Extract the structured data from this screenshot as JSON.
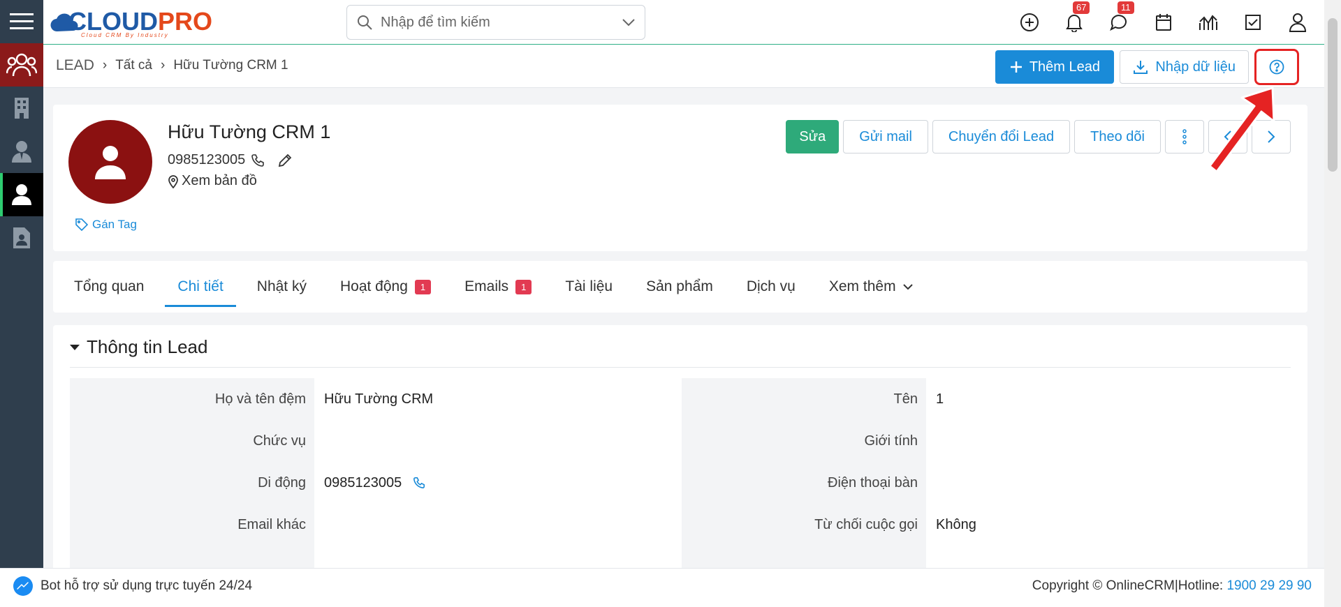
{
  "header": {
    "logo_main": "CLOUD",
    "logo_accent": "PRO",
    "logo_tagline": "Cloud CRM By Industry",
    "search_placeholder": "Nhập để tìm kiếm",
    "notifications_count": "67",
    "messages_count": "11"
  },
  "breadcrumb": {
    "root": "LEAD",
    "level1": "Tất cả",
    "current": "Hữu Tường CRM 1"
  },
  "toolbar": {
    "add_label": "Thêm Lead",
    "import_label": "Nhập dữ liệu"
  },
  "profile": {
    "name": "Hữu Tường CRM 1",
    "phone": "0985123005",
    "map_label": "Xem bản đồ",
    "tag_label": "Gán Tag",
    "actions": {
      "edit": "Sửa",
      "send_mail": "Gửi mail",
      "convert": "Chuyển đổi Lead",
      "follow": "Theo dõi"
    }
  },
  "tabs": {
    "overview": "Tổng quan",
    "detail": "Chi tiết",
    "log": "Nhật ký",
    "activity": "Hoạt động",
    "activity_badge": "1",
    "emails": "Emails",
    "emails_badge": "1",
    "documents": "Tài liệu",
    "products": "Sản phẩm",
    "services": "Dịch vụ",
    "more": "Xem thêm"
  },
  "lead_info": {
    "title": "Thông tin Lead",
    "left": {
      "fullname_label": "Họ và tên đệm",
      "fullname_value": "Hữu Tường CRM",
      "position_label": "Chức vụ",
      "mobile_label": "Di động",
      "mobile_value": "0985123005",
      "other_email_label": "Email khác"
    },
    "right": {
      "name_label": "Tên",
      "name_value": "1",
      "gender_label": "Giới tính",
      "landline_label": "Điện thoại bàn",
      "reject_call_label": "Từ chối cuộc gọi",
      "reject_call_value": "Không"
    }
  },
  "footer": {
    "bot_text": "Bot hỗ trợ sử dụng trực tuyến 24/24",
    "copyright": "Copyright © OnlineCRM|Hotline: ",
    "hotline": "1900 29 29 90"
  },
  "colors": {
    "primary": "#1a8bd8",
    "success": "#2eaa7a",
    "brand_red": "#8b1a1a",
    "sidebar": "#2f3e4d",
    "annotation": "#e52323"
  }
}
